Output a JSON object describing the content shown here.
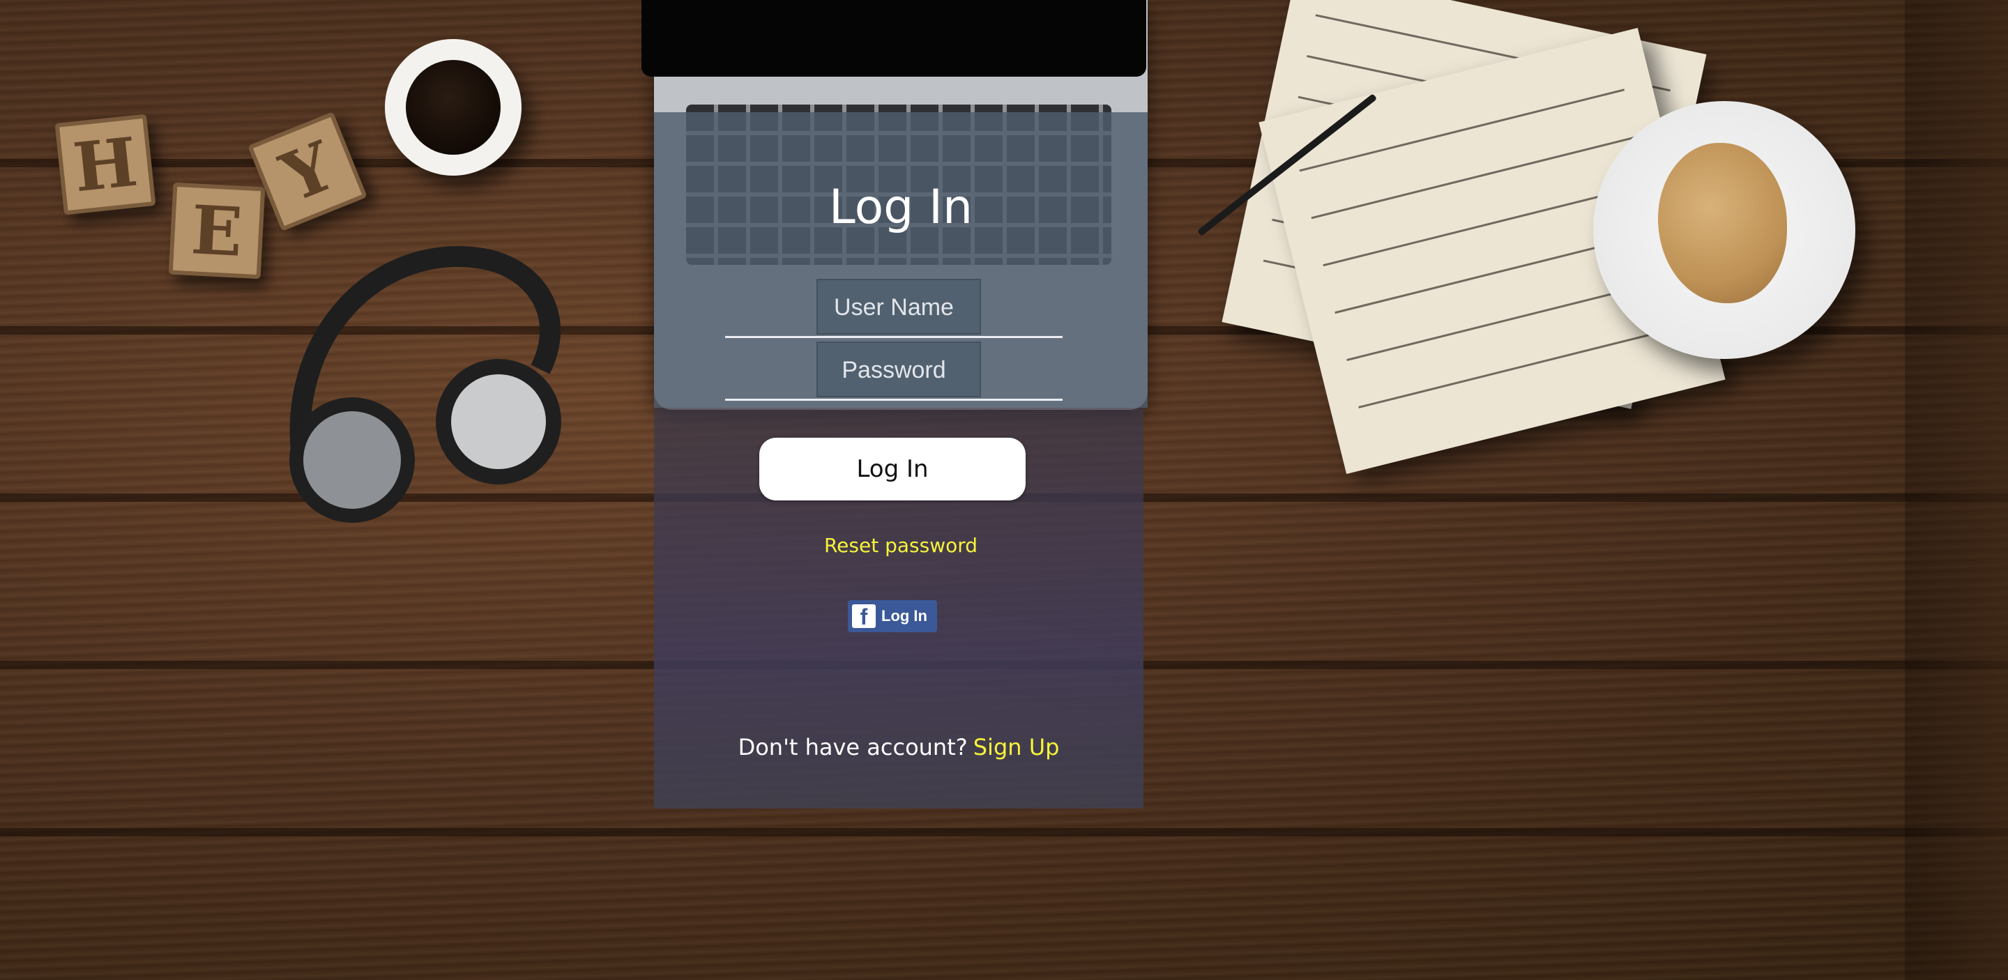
{
  "login": {
    "title": "Log In",
    "username_placeholder": "User Name",
    "password_placeholder": "Password",
    "submit_label": "Log In",
    "reset_password_label": "Reset password",
    "facebook": {
      "icon_glyph": "f",
      "label": "Log In",
      "color": "#3b5998"
    },
    "signup_prompt": "Don't have account?",
    "signup_label": "Sign Up"
  },
  "decor": {
    "letters": [
      "H",
      "E",
      "Y"
    ]
  },
  "colors": {
    "accent_yellow": "#f6f43a",
    "panel_top": "#505e6e",
    "button_bg": "#ffffff"
  }
}
